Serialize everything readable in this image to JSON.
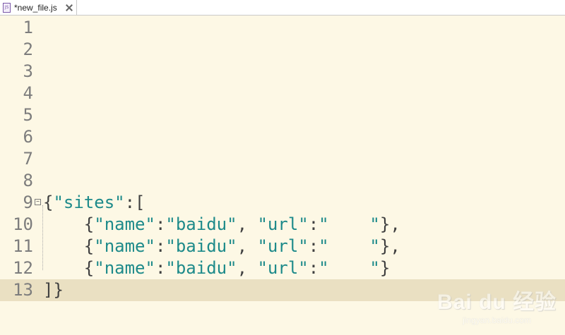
{
  "tab": {
    "title": "*new_file.js",
    "icon": "js-file-icon",
    "close_icon": "close-icon"
  },
  "lines": [
    {
      "number": "1",
      "text": ""
    },
    {
      "number": "2",
      "text": ""
    },
    {
      "number": "3",
      "text": ""
    },
    {
      "number": "4",
      "text": ""
    },
    {
      "number": "5",
      "text": ""
    },
    {
      "number": "6",
      "text": ""
    },
    {
      "number": "7",
      "text": ""
    },
    {
      "number": "8",
      "text": ""
    },
    {
      "number": "9",
      "text": "{\"sites\":["
    },
    {
      "number": "10",
      "text": "    {\"name\":\"baidu\", \"url\":\"    \"},"
    },
    {
      "number": "11",
      "text": "    {\"name\":\"baidu\", \"url\":\"    \"},"
    },
    {
      "number": "12",
      "text": "    {\"name\":\"baidu\", \"url\":\"    \"}"
    },
    {
      "number": "13",
      "text": "]}"
    }
  ],
  "current_line": "13",
  "colors": {
    "background": "#fdf8e5",
    "current_line_bg": "#eae0c2",
    "string": "#1d8a8a",
    "line_number": "#7d7d7d"
  },
  "watermark": {
    "logo": "Bai du 经验",
    "sub": "jingyan.baidu.com"
  }
}
